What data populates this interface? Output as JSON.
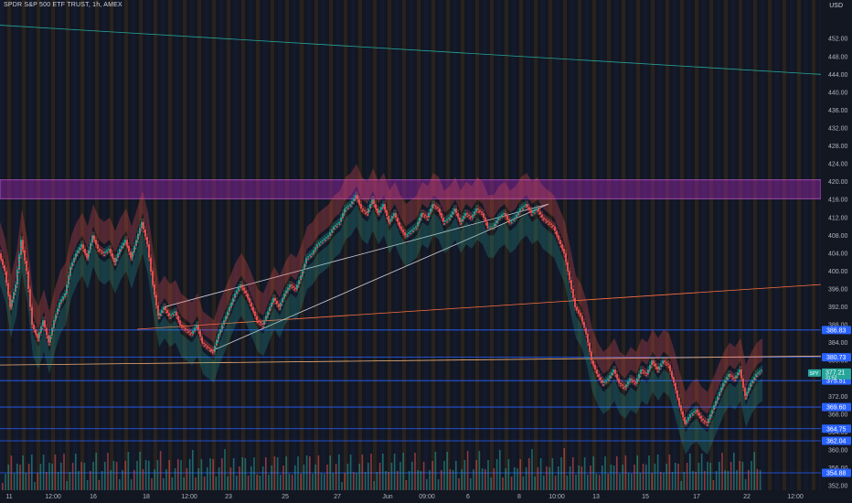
{
  "header": {
    "symbol_title": "SPDR S&P 500 ETF TRUST, 1h, AMEX",
    "currency": "USD"
  },
  "colors": {
    "background": "#131722",
    "up": "#26a69a",
    "down": "#ef5350",
    "zone": "#9c27b0",
    "level_line": "#2962ff",
    "label_bg": "#2962ff",
    "last_price_bg": "#26a69a"
  },
  "chart_data": {
    "type": "candlestick",
    "price_axis_ticks": [
      "452.00",
      "448.00",
      "444.00",
      "440.00",
      "436.00",
      "432.00",
      "428.00",
      "424.00",
      "420.00",
      "416.00",
      "412.00",
      "408.00",
      "404.00",
      "400.00",
      "396.00",
      "392.00",
      "388.00",
      "384.00",
      "380.00",
      "376.00",
      "372.00",
      "368.00",
      "364.00",
      "360.00",
      "356.00",
      "352.00"
    ],
    "price_range": [
      351.0,
      459.0
    ],
    "time_axis_ticks": [
      "11",
      "12:00",
      "16",
      "18",
      "12:00",
      "23",
      "25",
      "27",
      "Jun",
      "09:00",
      "6",
      "8",
      "10:00",
      "13",
      "15",
      "17",
      "22",
      "12:00"
    ],
    "price_labels": [
      {
        "price": 386.83,
        "text": "386.83"
      },
      {
        "price": 380.73,
        "text": "380.73"
      },
      {
        "price": 375.51,
        "text": "375.51"
      },
      {
        "price": 369.6,
        "text": "369.60"
      },
      {
        "price": 364.75,
        "text": "364.75"
      },
      {
        "price": 362.04,
        "text": "362.04"
      },
      {
        "price": 354.88,
        "text": "354.88"
      }
    ],
    "last_price": {
      "symbol": "SPY",
      "price": 377.21,
      "text": "377.21",
      "sub": "31:52"
    },
    "resistance_zone": [
      416.2,
      420.4
    ],
    "price_path": [
      [
        0,
        404
      ],
      [
        6,
        400
      ],
      [
        12,
        392
      ],
      [
        18,
        397
      ],
      [
        24,
        407
      ],
      [
        30,
        400
      ],
      [
        36,
        388
      ],
      [
        42,
        385
      ],
      [
        48,
        389
      ],
      [
        54,
        384
      ],
      [
        60,
        389
      ],
      [
        66,
        393
      ],
      [
        72,
        395
      ],
      [
        78,
        401
      ],
      [
        84,
        404
      ],
      [
        90,
        406
      ],
      [
        96,
        403
      ],
      [
        102,
        408
      ],
      [
        108,
        405
      ],
      [
        114,
        404
      ],
      [
        120,
        405
      ],
      [
        126,
        402
      ],
      [
        132,
        405
      ],
      [
        138,
        407
      ],
      [
        144,
        403
      ],
      [
        150,
        407
      ],
      [
        156,
        411
      ],
      [
        162,
        406
      ],
      [
        168,
        397
      ],
      [
        174,
        390
      ],
      [
        180,
        392
      ],
      [
        186,
        390
      ],
      [
        192,
        391
      ],
      [
        198,
        388
      ],
      [
        204,
        387
      ],
      [
        210,
        386
      ],
      [
        216,
        388
      ],
      [
        222,
        384
      ],
      [
        228,
        383
      ],
      [
        234,
        382
      ],
      [
        240,
        386
      ],
      [
        246,
        389
      ],
      [
        252,
        392
      ],
      [
        258,
        395
      ],
      [
        264,
        397
      ],
      [
        270,
        395
      ],
      [
        276,
        392
      ],
      [
        282,
        389
      ],
      [
        288,
        388
      ],
      [
        294,
        391
      ],
      [
        300,
        394
      ],
      [
        306,
        392
      ],
      [
        312,
        395
      ],
      [
        318,
        397
      ],
      [
        324,
        396
      ],
      [
        330,
        399
      ],
      [
        336,
        403
      ],
      [
        342,
        404
      ],
      [
        348,
        406
      ],
      [
        354,
        407
      ],
      [
        360,
        408
      ],
      [
        366,
        410
      ],
      [
        372,
        411
      ],
      [
        378,
        414
      ],
      [
        384,
        415
      ],
      [
        390,
        417
      ],
      [
        396,
        414
      ],
      [
        402,
        413
      ],
      [
        408,
        416
      ],
      [
        414,
        413
      ],
      [
        420,
        415
      ],
      [
        426,
        411
      ],
      [
        432,
        413
      ],
      [
        438,
        410
      ],
      [
        444,
        408
      ],
      [
        450,
        409
      ],
      [
        456,
        410
      ],
      [
        462,
        413
      ],
      [
        468,
        412
      ],
      [
        474,
        415
      ],
      [
        480,
        414
      ],
      [
        486,
        411
      ],
      [
        492,
        412
      ],
      [
        498,
        414
      ],
      [
        504,
        411
      ],
      [
        510,
        413
      ],
      [
        516,
        412
      ],
      [
        522,
        414
      ],
      [
        528,
        413
      ],
      [
        534,
        410
      ],
      [
        540,
        410
      ],
      [
        546,
        412
      ],
      [
        552,
        413
      ],
      [
        558,
        411
      ],
      [
        564,
        412
      ],
      [
        570,
        414
      ],
      [
        576,
        415
      ],
      [
        582,
        413
      ],
      [
        588,
        414
      ],
      [
        594,
        412
      ],
      [
        600,
        411
      ],
      [
        606,
        410
      ],
      [
        612,
        407
      ],
      [
        618,
        404
      ],
      [
        624,
        398
      ],
      [
        630,
        392
      ],
      [
        636,
        390
      ],
      [
        642,
        386
      ],
      [
        648,
        380
      ],
      [
        654,
        377
      ],
      [
        660,
        375
      ],
      [
        666,
        376
      ],
      [
        672,
        378
      ],
      [
        678,
        375
      ],
      [
        684,
        374
      ],
      [
        690,
        376
      ],
      [
        696,
        375
      ],
      [
        702,
        378
      ],
      [
        708,
        377
      ],
      [
        714,
        380
      ],
      [
        720,
        378
      ],
      [
        726,
        380
      ],
      [
        732,
        379
      ],
      [
        738,
        375
      ],
      [
        744,
        370
      ],
      [
        750,
        366
      ],
      [
        756,
        368
      ],
      [
        762,
        369
      ],
      [
        768,
        367
      ],
      [
        774,
        366
      ],
      [
        780,
        369
      ],
      [
        786,
        372
      ],
      [
        792,
        375
      ],
      [
        798,
        377
      ],
      [
        804,
        376
      ],
      [
        810,
        378
      ],
      [
        816,
        372
      ],
      [
        822,
        375
      ],
      [
        828,
        377
      ],
      [
        834,
        378
      ]
    ],
    "time_span_pixels_note": ""
  }
}
